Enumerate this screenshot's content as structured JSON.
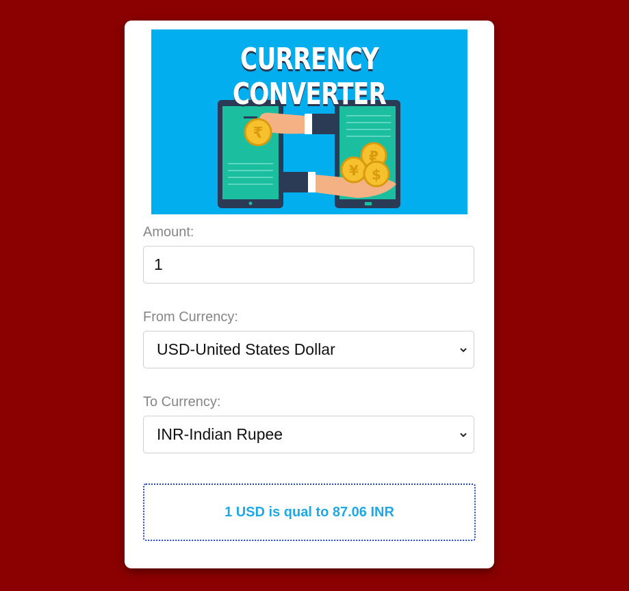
{
  "banner": {
    "title": "CURRENCY CONVERTER",
    "colors": {
      "background": "#03aeef",
      "phone": "#2b3a55",
      "screen": "#1bbfa0",
      "coin": "#f6c12d"
    }
  },
  "form": {
    "amount_label": "Amount:",
    "amount_value": "1",
    "from_label": "From Currency:",
    "from_value": "USD-United States Dollar",
    "to_label": "To Currency:",
    "to_value": "INR-Indian Rupee"
  },
  "result": {
    "text": "1 USD is qual to 87.06 INR"
  },
  "colors": {
    "page_background": "#8b0000",
    "card_background": "#ffffff",
    "result_text": "#1ea8e6",
    "result_border": "#2340c8"
  }
}
